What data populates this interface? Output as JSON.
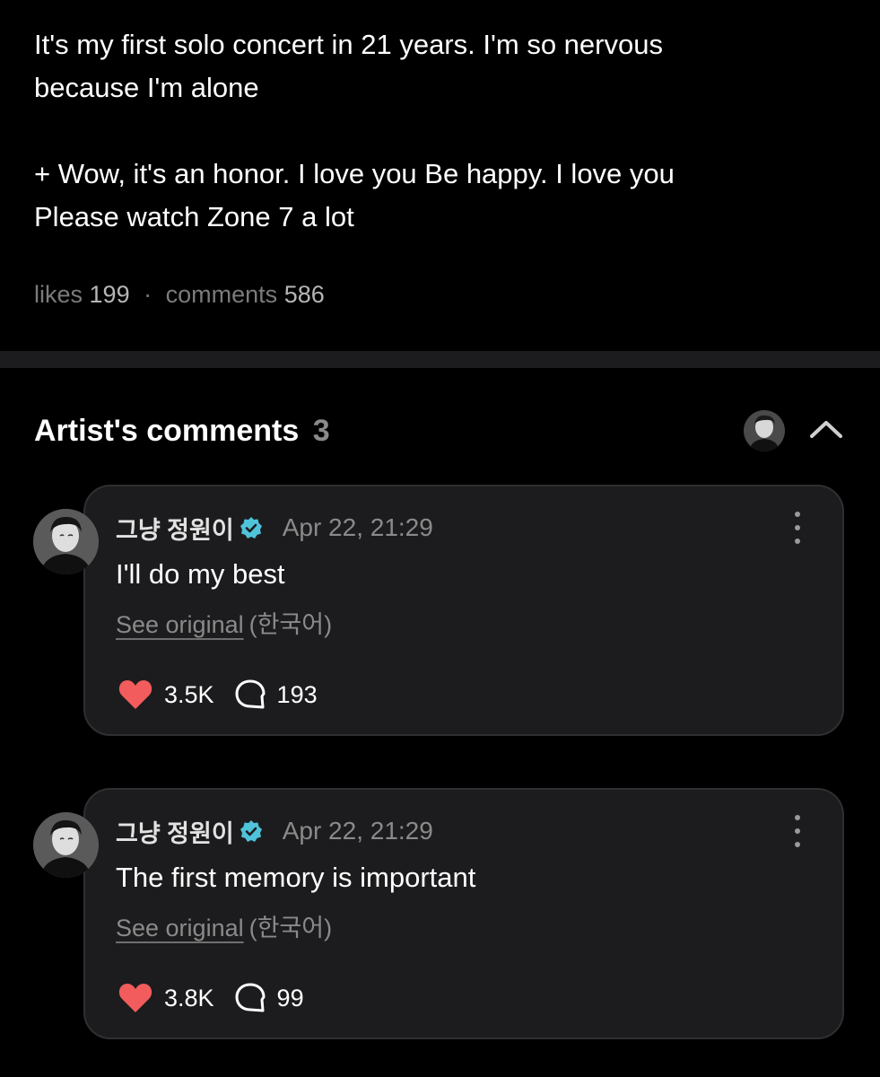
{
  "post": {
    "lines": [
      "It's my first solo concert in 21 years. I'm so nervous",
      "because I'm alone",
      "+ Wow, it's an honor. I love you Be happy. I love you",
      "Please watch Zone 7 a lot"
    ],
    "likes_label": "likes",
    "likes_count": "199",
    "separator": "·",
    "comments_label": "comments",
    "comments_count": "586"
  },
  "artist_comments": {
    "title": "Artist's comments",
    "count": "3",
    "collapse_icon": "chevron-up-icon",
    "items": [
      {
        "author": "그냥 정원이",
        "verified_icon": "verified-badge-icon",
        "timestamp": "Apr 22, 21:29",
        "text": "I'll do my best",
        "see_original": "See original",
        "language": "(한국어)",
        "likes": "3.5K",
        "replies": "193"
      },
      {
        "author": "그냥 정원이",
        "verified_icon": "verified-badge-icon",
        "timestamp": "Apr 22, 21:29",
        "text": "The first memory is important",
        "see_original": "See original",
        "language": "(한국어)",
        "likes": "3.8K",
        "replies": "99"
      }
    ]
  },
  "colors": {
    "background": "#000000",
    "card": "#1c1c1e",
    "heart": "#f25c5c",
    "verified": "#4fc3d9",
    "muted_text": "#8a8a8a"
  }
}
